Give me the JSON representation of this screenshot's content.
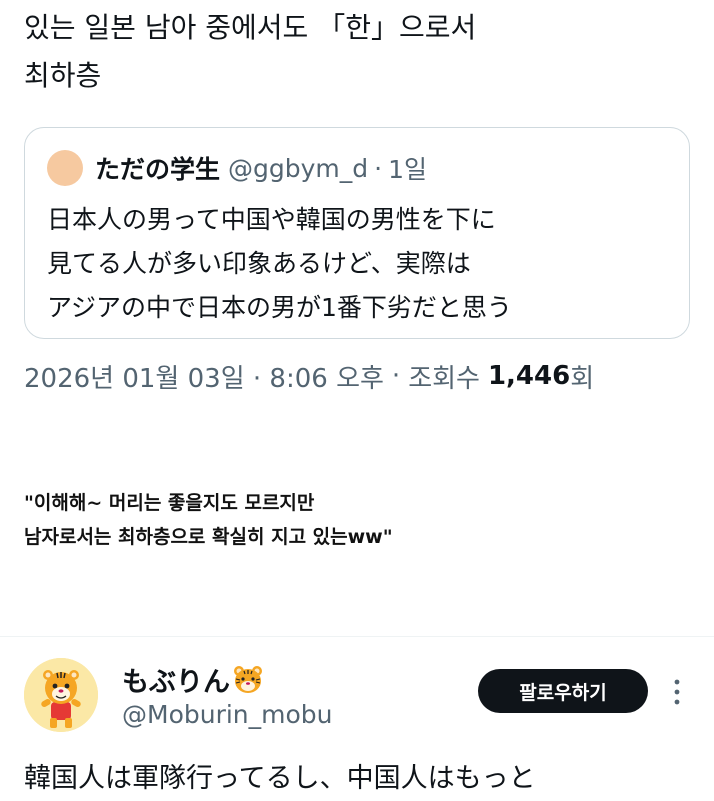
{
  "top_tweet": {
    "text_line1": "있는 일본 남아 중에서도 「한」으로서",
    "text_line2": "최하층"
  },
  "quote": {
    "author_name": "ただの学生",
    "author_handle": "@ggbym_d",
    "separator": "·",
    "time": "1일",
    "lines": [
      "日本人の男って中国や韓国の男性を下に",
      "見てる人が多い印象あるけど、実際は",
      "アジアの中で日本の男が1番下劣だと思う"
    ]
  },
  "meta": {
    "date_time": "2026년 01월 03일 · 8:06 오후",
    "separator": "·",
    "views_label": "조회수",
    "views_count": "1,446",
    "views_suffix": "회"
  },
  "caption": {
    "line1": "\"이해해~ 머리는 좋을지도 모르지만",
    "line2": "남자로서는 최하층으로 확실히 지고 있는ww\""
  },
  "second_tweet": {
    "author_name": "もぶりん",
    "author_emoji": "tiger-face-icon",
    "author_handle": "@Moburin_mobu",
    "follow_label": "팔로우하기",
    "text": "韓国人は軍隊行ってるし、中国人はもっと"
  },
  "colors": {
    "text": "#0f1419",
    "secondary": "#536471",
    "border": "#cfd9de",
    "follow_bg": "#0f1419",
    "follow_text": "#ffffff"
  }
}
